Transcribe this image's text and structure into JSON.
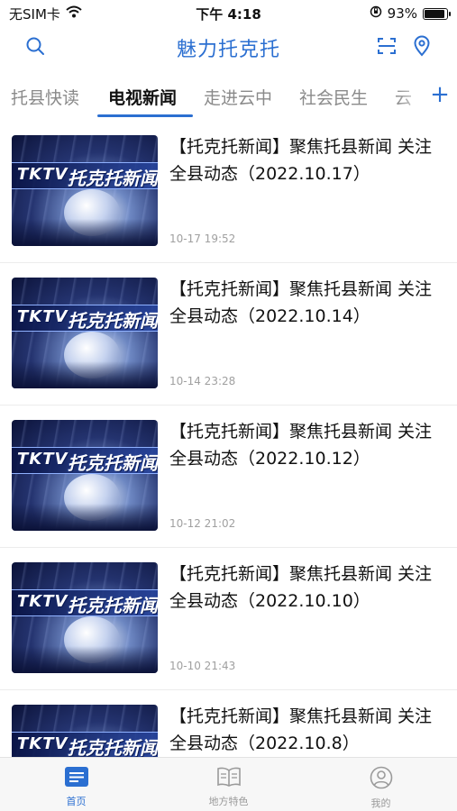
{
  "status_bar": {
    "carrier": "无SIM卡",
    "time": "下午 4:18",
    "battery": "93%",
    "battery_level": 0.93
  },
  "header": {
    "title": "魅力托克托",
    "search_icon": "search-icon",
    "scan_icon": "scan-icon",
    "location_icon": "location-pin-icon"
  },
  "tabs": [
    {
      "label": "托县快读",
      "active": false
    },
    {
      "label": "电视新闻",
      "active": true
    },
    {
      "label": "走进云中",
      "active": false
    },
    {
      "label": "社会民生",
      "active": false
    },
    {
      "label": "云",
      "active": false
    }
  ],
  "add_tab": "+",
  "thumbnail": {
    "badge": "TKTV",
    "caption": "托克托新闻"
  },
  "news": [
    {
      "title": "【托克托新闻】聚焦托县新闻 关注全县动态（2022.10.17）",
      "time": "10-17 19:52"
    },
    {
      "title": "【托克托新闻】聚焦托县新闻 关注全县动态（2022.10.14）",
      "time": "10-14 23:28"
    },
    {
      "title": "【托克托新闻】聚焦托县新闻 关注全县动态（2022.10.12）",
      "time": "10-12 21:02"
    },
    {
      "title": "【托克托新闻】聚焦托县新闻 关注全县动态（2022.10.10）",
      "time": "10-10 21:43"
    },
    {
      "title": "【托克托新闻】聚焦托县新闻 关注全县动态（2022.10.8）",
      "time": ""
    }
  ],
  "bottom_nav": [
    {
      "label": "首页",
      "icon": "home-grid-icon",
      "active": true
    },
    {
      "label": "地方特色",
      "icon": "open-book-icon",
      "active": false
    },
    {
      "label": "我的",
      "icon": "user-profile-icon",
      "active": false
    }
  ],
  "colors": {
    "accent": "#2b6fd1",
    "inactive_text": "#8a8a8a",
    "time_text": "#a0a0a0"
  }
}
